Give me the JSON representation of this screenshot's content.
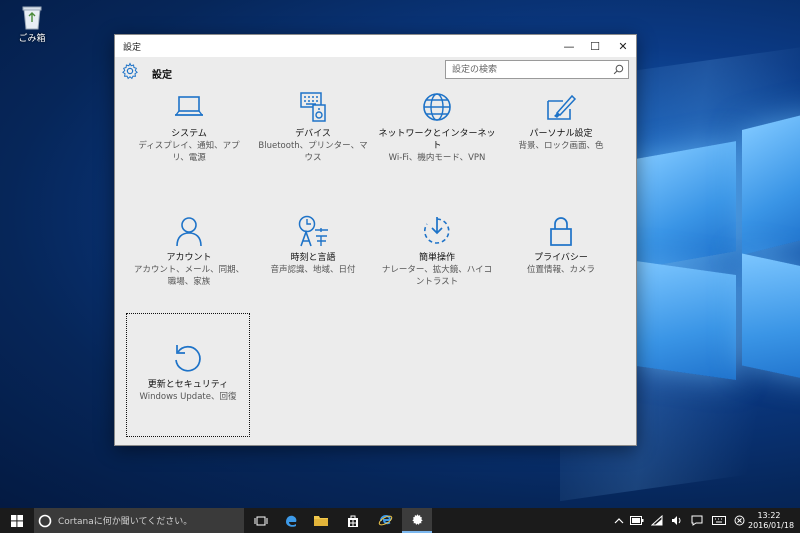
{
  "desktop": {
    "recycle_bin_label": "ごみ箱"
  },
  "window": {
    "title": "設定",
    "controls": {
      "minimize": "—",
      "maximize": "☐",
      "close": "✕"
    },
    "header_title": "設定",
    "search_placeholder": "設定の検索"
  },
  "tiles": [
    {
      "title": "システム",
      "desc": "ディスプレイ、通知、アプリ、電源",
      "icon": "laptop-icon"
    },
    {
      "title": "デバイス",
      "desc": "Bluetooth、プリンター、マウス",
      "icon": "keyboard-speaker-icon"
    },
    {
      "title": "ネットワークとインターネット",
      "desc": "Wi-Fi、機内モード、VPN",
      "icon": "globe-icon"
    },
    {
      "title": "パーソナル設定",
      "desc": "背景、ロック画面、色",
      "icon": "paint-brush-icon"
    },
    {
      "title": "アカウント",
      "desc": "アカウント、メール、同期、職場、家族",
      "icon": "person-icon"
    },
    {
      "title": "時刻と言語",
      "desc": "音声認識、地域、日付",
      "icon": "clock-language-icon"
    },
    {
      "title": "簡単操作",
      "desc": "ナレーター、拡大鏡、ハイコントラスト",
      "icon": "ease-of-access-icon"
    },
    {
      "title": "プライバシー",
      "desc": "位置情報、カメラ",
      "icon": "lock-icon"
    },
    {
      "title": "更新とセキュリティ",
      "desc": "Windows Update、回復",
      "icon": "refresh-icon"
    }
  ],
  "taskbar": {
    "cortana_text": "Cortanaに何か聞いてください。",
    "clock_time": "13:22",
    "clock_date": "2016/01/18"
  },
  "colors": {
    "accent": "#1e73c8",
    "window_bg": "#ececec",
    "taskbar_bg": "#1b1b1b"
  }
}
